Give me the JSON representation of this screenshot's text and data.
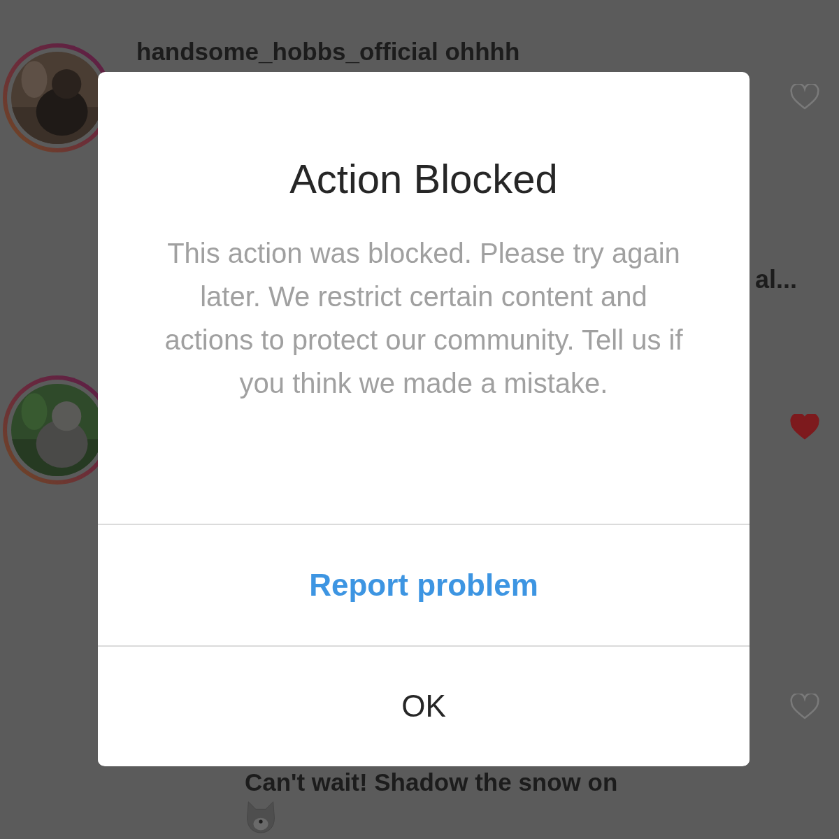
{
  "comments": [
    {
      "kind": "comment",
      "text": "handsome_hobbs_official ohhhh",
      "trailing": "al...",
      "liked": false
    },
    {
      "kind": "comment",
      "liked": true
    },
    {
      "kind": "reply",
      "text": "Can't wait! Shadow the snow on",
      "liked": false
    }
  ],
  "dialog": {
    "title": "Action Blocked",
    "message": "This action was blocked. Please try again later. We restrict certain content and actions to protect our community. Tell us if you think we made a mistake.",
    "buttons": [
      {
        "kind": "primary",
        "label": "Report problem"
      },
      {
        "kind": "plain",
        "label": "OK"
      }
    ]
  }
}
